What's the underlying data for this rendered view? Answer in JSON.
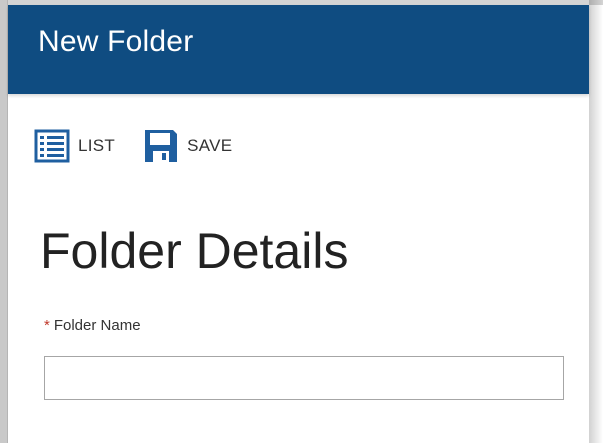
{
  "window": {
    "title": "New Folder"
  },
  "toolbar": {
    "list_label": "LIST",
    "save_label": "SAVE",
    "list_icon": "list-icon",
    "save_icon": "save-icon"
  },
  "form": {
    "section_title": "Folder Details",
    "required_marker": "*",
    "folder_name_label": "Folder Name",
    "folder_name_value": ""
  },
  "colors": {
    "title_bar": "#0f4c81",
    "icon": "#1f5fa0",
    "required": "#c0392b"
  }
}
